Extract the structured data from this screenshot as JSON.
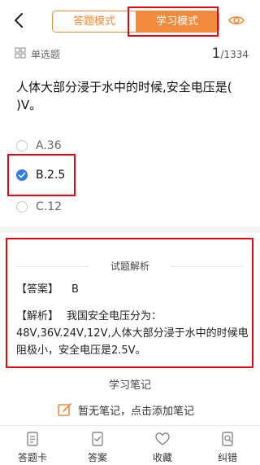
{
  "header": {
    "tabs": [
      {
        "label": "答题模式",
        "active": false
      },
      {
        "label": "学习模式",
        "active": true
      }
    ]
  },
  "question_meta": {
    "type": "单选题",
    "current": "1",
    "total": "/1334"
  },
  "question": {
    "text": "人体大部分浸于水中的时候,安全电压是(   )V。"
  },
  "options": [
    {
      "label": "A.36",
      "selected": false
    },
    {
      "label": "B.2.5",
      "selected": true
    },
    {
      "label": "C.12",
      "selected": false
    }
  ],
  "analysis": {
    "title": "试题解析",
    "answer_tag": "【答案】",
    "answer_value": "B",
    "explain_tag": "【解析】",
    "explain_text": "我国安全电压分为：48V,36V.24V,12V,人体大部分浸于水中的时候电阻极小，安全电压是2.5V。"
  },
  "notes": {
    "title": "学习笔记",
    "add_label": "暂无笔记，点击添加笔记"
  },
  "bottom_nav": [
    {
      "label": "答题卡",
      "icon": "answer-sheet-icon"
    },
    {
      "label": "答案",
      "icon": "answer-icon"
    },
    {
      "label": "收藏",
      "icon": "heart-icon"
    },
    {
      "label": "纠错",
      "icon": "report-error-icon"
    }
  ],
  "colors": {
    "accent": "#f08a3c",
    "highlight": "#e60012",
    "selected": "#2f7de1"
  }
}
